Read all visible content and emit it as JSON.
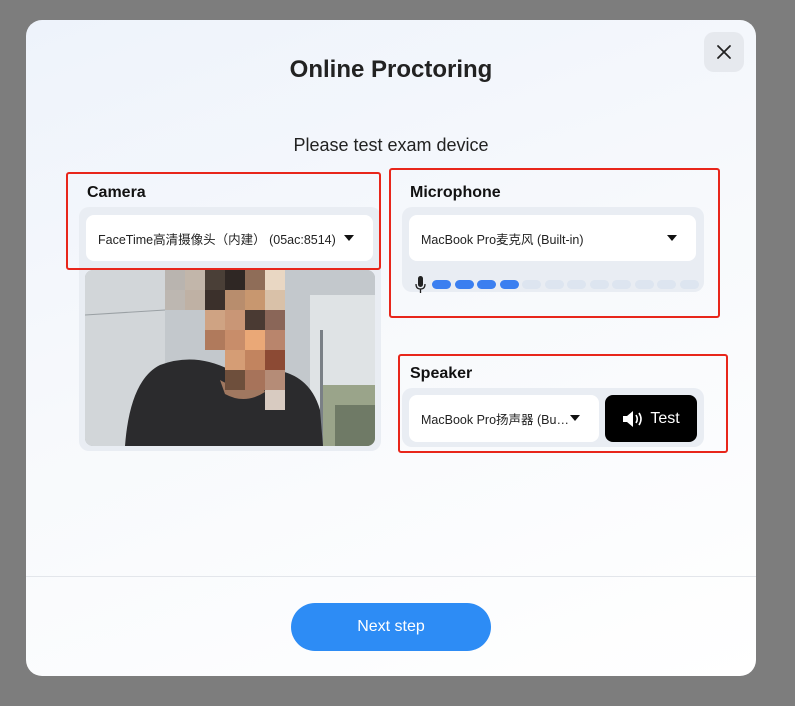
{
  "modal": {
    "title": "Online Proctoring",
    "subtitle": "Please test exam device"
  },
  "camera": {
    "label": "Camera",
    "selected": "FaceTime高清摄像头（内建） (05ac:8514)"
  },
  "microphone": {
    "label": "Microphone",
    "selected": "MacBook Pro麦克风 (Built-in)",
    "level_active_segments": 4,
    "level_total_segments": 12
  },
  "speaker": {
    "label": "Speaker",
    "selected": "MacBook Pro扬声器 (Buil...",
    "test_label": "Test"
  },
  "footer": {
    "next_label": "Next step"
  },
  "colors": {
    "accent": "#2d8cf5",
    "level_active": "#3b7ff0",
    "level_inactive": "#dde5f0",
    "annotation": "#e8261b"
  }
}
